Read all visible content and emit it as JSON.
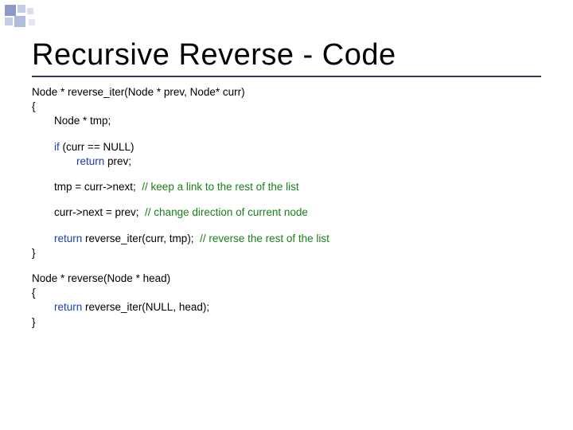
{
  "title": "Recursive Reverse - Code",
  "code": {
    "sig1": "Node * reverse_iter(Node * prev, Node* curr)",
    "open": "{",
    "tmp": "Node * tmp;",
    "ifline_a": "if",
    "ifline_b": " (curr == NULL)",
    "ret1_a": "return",
    "ret1_b": " prev;",
    "assign1_a": "tmp = curr->next;  ",
    "assign1_c": "// keep a link to the rest of the list",
    "assign2_a": "curr->next = prev;  ",
    "assign2_c": "// change direction of current node",
    "ret2_a": "return",
    "ret2_b": " reverse_iter(curr, tmp);  ",
    "ret2_c": "// reverse the rest of the list",
    "close": "}",
    "sig2": "Node * reverse(Node * head)",
    "open2": "{",
    "ret3_a": "return",
    "ret3_b": " reverse_iter(NULL, head);",
    "close2": "}"
  }
}
